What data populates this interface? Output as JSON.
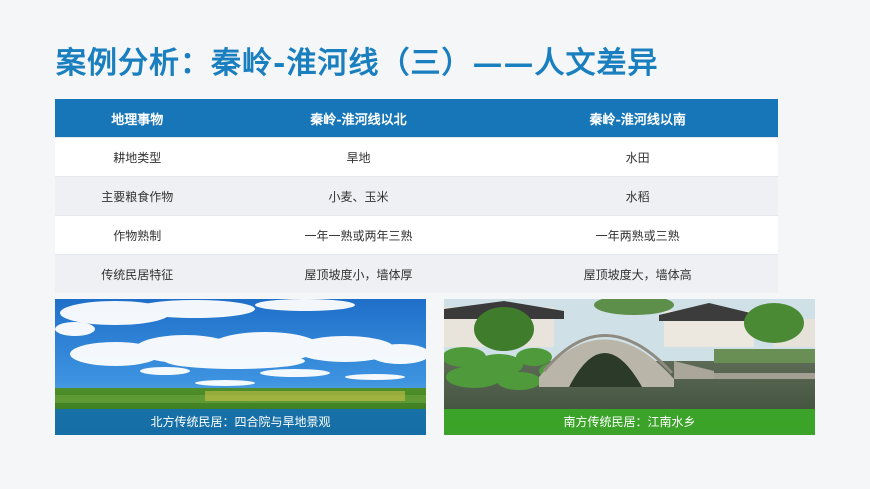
{
  "title": "案例分析：秦岭-淮河线（三）——人文差异",
  "table": {
    "headers": [
      "地理事物",
      "秦岭-淮河线以北",
      "秦岭-淮河线以南"
    ],
    "rows": [
      [
        "耕地类型",
        "旱地",
        "水田"
      ],
      [
        "主要粮食作物",
        "小麦、玉米",
        "水稻"
      ],
      [
        "作物熟制",
        "一年一熟或两年三熟",
        "一年两熟或三熟"
      ],
      [
        "传统民居特征",
        "屋顶坡度小，墙体厚",
        "屋顶坡度大，墙体高"
      ]
    ]
  },
  "photos": {
    "left_caption": "北方传统民居：四合院与旱地景观",
    "right_caption": "南方传统民居：江南水乡"
  },
  "colors": {
    "title": "#1a7fbf",
    "header_bg": "#1776b8",
    "caption_blue": "#106ebe",
    "caption_green": "#3caa28"
  }
}
